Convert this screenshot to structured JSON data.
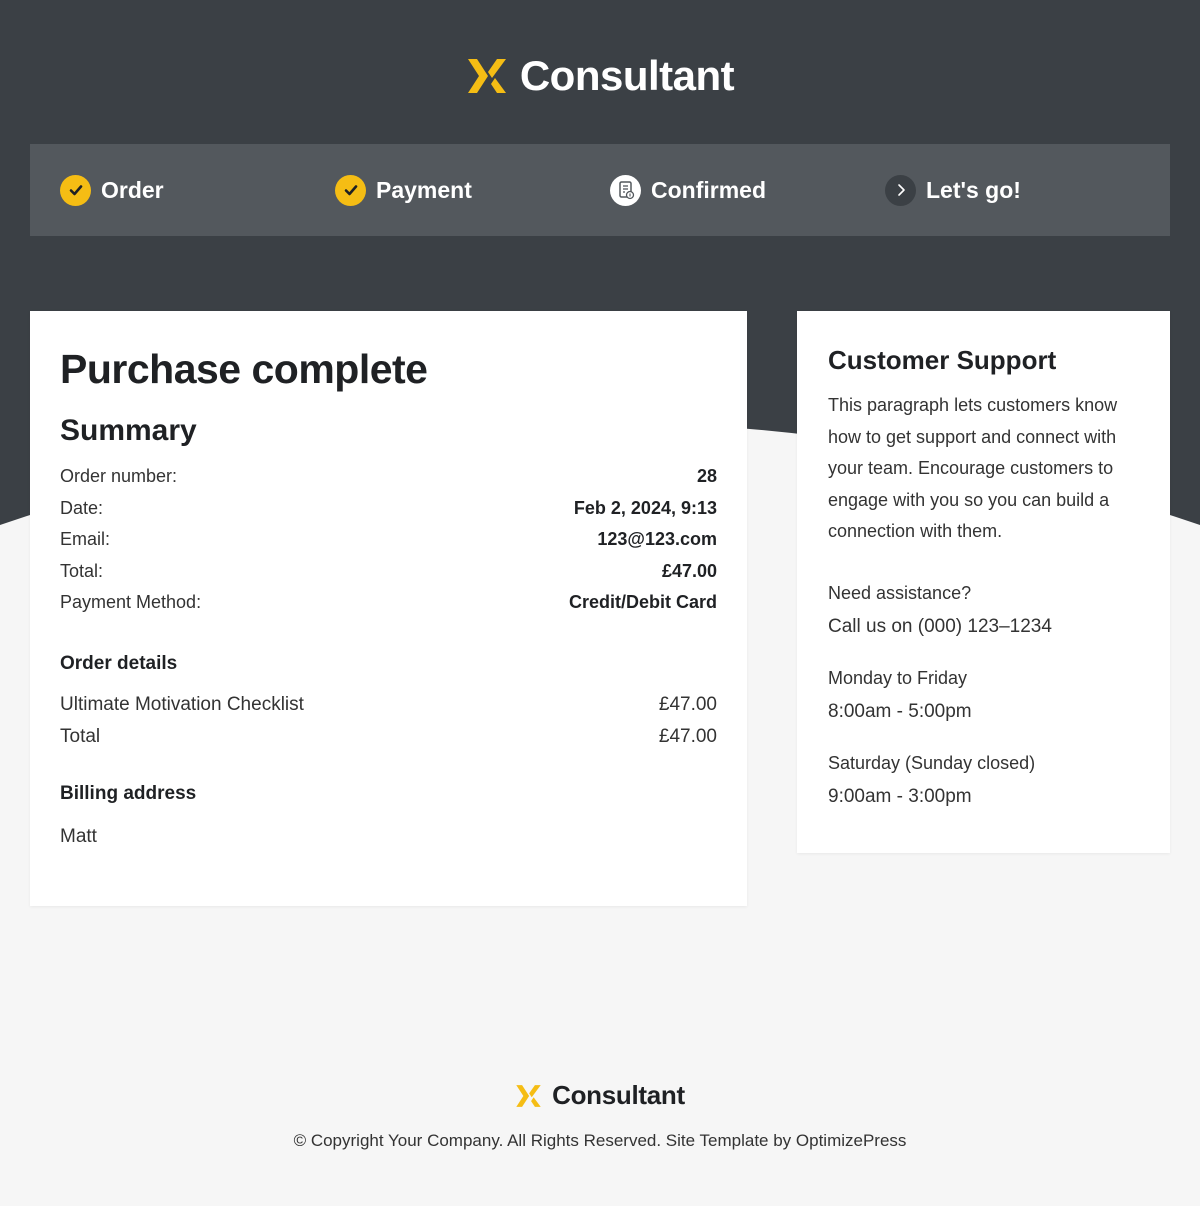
{
  "brand": {
    "name": "Consultant",
    "accent_color": "#f5bd14",
    "dark_color": "#3b4045",
    "steps_bg_color": "#53585d"
  },
  "steps": [
    {
      "label": "Order",
      "state": "done",
      "icon": "check-circle-icon"
    },
    {
      "label": "Payment",
      "state": "done",
      "icon": "check-circle-icon"
    },
    {
      "label": "Confirmed",
      "state": "current",
      "icon": "receipt-icon"
    },
    {
      "label": "Let's go!",
      "state": "next",
      "icon": "chevron-right-icon"
    }
  ],
  "purchase": {
    "title": "Purchase complete",
    "summary_title": "Summary",
    "summary": [
      {
        "label": "Order number:",
        "value": "28"
      },
      {
        "label": "Date:",
        "value": "Feb 2, 2024, 9:13"
      },
      {
        "label": "Email:",
        "value": "123@123.com"
      },
      {
        "label": "Total:",
        "value": "£47.00"
      },
      {
        "label": "Payment Method:",
        "value": "Credit/Debit Card"
      }
    ],
    "order_details_title": "Order details",
    "items": [
      {
        "name": "Ultimate Motivation Checklist",
        "price": "£47.00"
      },
      {
        "name": "Total",
        "price": "£47.00"
      }
    ],
    "billing_title": "Billing address",
    "billing_name": "Matt"
  },
  "support": {
    "title": "Customer Support",
    "paragraph": "This paragraph lets customers know how to get support and connect with your team. Encourage customers to engage with you so you can build a connection with them.",
    "assist_label": "Need assistance?",
    "phone_line": "Call us on (000) 123–1234",
    "weekday_label": "Monday to Friday",
    "weekday_hours": "8:00am - 5:00pm",
    "saturday_label": "Saturday (Sunday closed)",
    "saturday_hours": "9:00am - 3:00pm"
  },
  "footer": {
    "brand": "Consultant",
    "copyright": "© Copyright Your Company.  All Rights Reserved. Site Template by OptimizePress"
  }
}
